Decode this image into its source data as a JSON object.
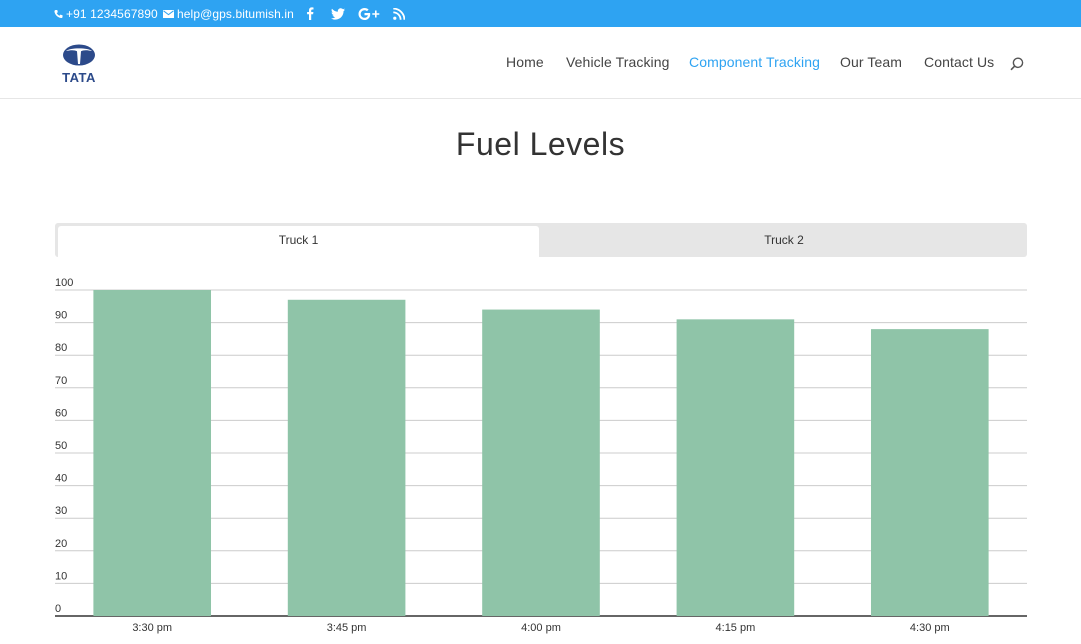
{
  "topbar": {
    "phone": "+91 1234567890",
    "email": "help@gps.bitumish.in",
    "social_icons": [
      "facebook-icon",
      "twitter-icon",
      "google-plus-icon",
      "rss-icon"
    ],
    "bg_color": "#2ea3f2"
  },
  "header": {
    "logo_text": "TATA",
    "nav": [
      {
        "label": "Home",
        "active": false
      },
      {
        "label": "Vehicle Tracking",
        "active": false
      },
      {
        "label": "Component Tracking",
        "active": true
      },
      {
        "label": "Our Team",
        "active": false
      },
      {
        "label": "Contact Us",
        "active": false
      }
    ],
    "accent_color": "#2ea3f2"
  },
  "page": {
    "title": "Fuel Levels",
    "tabs": [
      {
        "label": "Truck 1",
        "selected": true
      },
      {
        "label": "Truck 2",
        "selected": false
      }
    ]
  },
  "chart_data": {
    "type": "bar",
    "categories": [
      "3:30 pm",
      "3:45 pm",
      "4:00 pm",
      "4:15 pm",
      "4:30 pm"
    ],
    "values": [
      100,
      97,
      94,
      91,
      88
    ],
    "ylim": [
      0,
      100
    ],
    "yticks": [
      0,
      10,
      20,
      30,
      40,
      50,
      60,
      70,
      80,
      90,
      100
    ],
    "grid": true,
    "bar_color": "#8fc4a8",
    "title": "",
    "xlabel": "",
    "ylabel": ""
  }
}
